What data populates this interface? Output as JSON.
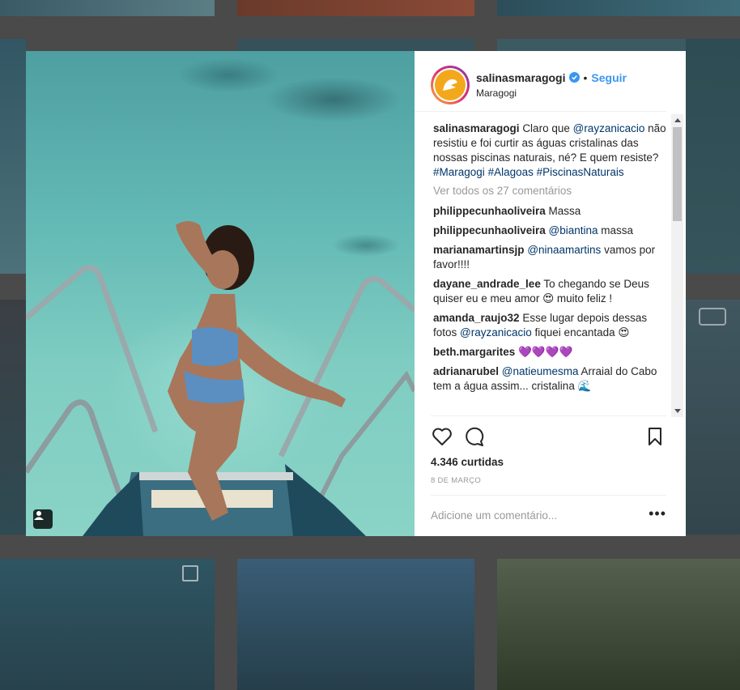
{
  "post": {
    "username": "salinasmaragogi",
    "follow_label": "Seguir",
    "separator": "•",
    "location": "Maragogi",
    "caption": {
      "user": "salinasmaragogi",
      "parts": [
        "Claro que ",
        "@rayzanicacio",
        " não resistiu e foi curtir as águas cristalinas das nossas piscinas naturais, né? E quem resiste? ",
        "#Maragogi",
        " ",
        "#Alagoas",
        " ",
        "#PiscinasNaturais"
      ]
    },
    "view_all": "Ver todos os 27 comentários",
    "comments": [
      {
        "user": "philippecunhaoliveira",
        "mention": "",
        "text": "Massa"
      },
      {
        "user": "philippecunhaoliveira",
        "mention": "@biantina",
        "text": " massa"
      },
      {
        "user": "marianamartinsjp",
        "mention": "@ninaamartins",
        "text": " vamos por favor!!!!"
      },
      {
        "user": "dayane_andrade_lee",
        "mention": "",
        "text": "To chegando se Deus quiser eu e meu amor 😍 muito feliz !"
      },
      {
        "user": "amanda_raujo32",
        "mention": "",
        "text": "Esse lugar depois dessas fotos "
      },
      {
        "user": "beth.margarites",
        "mention": "",
        "text": "💜💜💜💜"
      },
      {
        "user": "adrianarubel",
        "mention": "@natieumesma",
        "text": " Arraial do Cabo tem a água assim... cristalina 🌊"
      }
    ],
    "amanda_mention": "@rayzanicacio",
    "amanda_tail": " fiquei encantada 😍",
    "likes": "4.346 curtidas",
    "date": "8 DE MARÇO",
    "add_comment_placeholder": "Adicione um comentário...",
    "more_label": "•••"
  },
  "colors": {
    "link": "#3897f0",
    "mention": "#003569",
    "verified": "#3897f0",
    "avatar_bg": "#f3a81c"
  },
  "icons": [
    "user-tag-icon",
    "verified-icon",
    "heart-icon",
    "comment-icon",
    "bookmark-icon",
    "more-options-icon",
    "multiple-photos-icon",
    "video-icon"
  ]
}
